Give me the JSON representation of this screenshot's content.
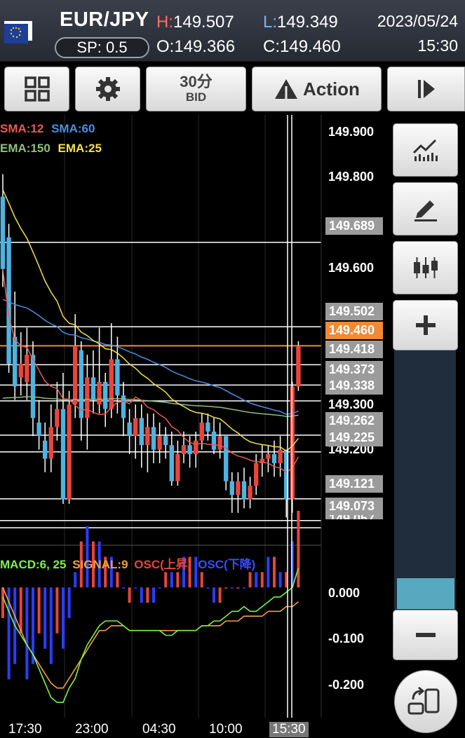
{
  "header": {
    "pair": "EUR/JPY",
    "spread": "SP: 0.5",
    "high_key": "H:",
    "high": "149.507",
    "open_key": "O:",
    "open": "149.366",
    "low_key": "L:",
    "low": "149.349",
    "close_key": "C:",
    "close": "149.460",
    "date": "2023/05/24",
    "time": "15:30"
  },
  "toolbar": {
    "timeframe": "30分",
    "price_type": "BID",
    "action_label": "Action"
  },
  "legend": {
    "sma12": "SMA:12",
    "sma60": "SMA:60",
    "ema150": "EMA:150",
    "ema25": "EMA:25",
    "macd": "MACD:6, 25",
    "signal": "SIGNAL:9",
    "osc_up": "OSC(上昇)",
    "osc_down": "OSC(下降)"
  },
  "price_axis": {
    "p1": "149.900",
    "p2": "149.800",
    "p3": "149.600",
    "p4": "149.300",
    "p5": "149.200"
  },
  "price_boxes": {
    "b1": "149.689",
    "b2": "149.502",
    "current": "149.460",
    "b3": "149.418",
    "b4": "149.373",
    "b5": "149.338",
    "b6": "149.262",
    "b7": "149.225",
    "b8": "149.121",
    "b9": "149.073",
    "b10": "149.057"
  },
  "macd_axis": {
    "m1": "0.000",
    "m2": "-0.100",
    "m3": "-0.200"
  },
  "time_axis": {
    "t1": "17:30",
    "t2": "23:00",
    "t3": "04:30",
    "t4": "10:00",
    "t5": "15:30"
  },
  "colors": {
    "bull": "#e8453c",
    "bear": "#4fb3e0",
    "sma12": "#e85a50",
    "sma60": "#4a90e2",
    "ema150": "#8fbf7f",
    "ema25": "#f4e04d",
    "macd": "#7cf24a",
    "signal": "#f5a040",
    "current_price": "#f08a35"
  },
  "chart_data": {
    "type": "candlestick",
    "candles": [
      {
        "o": 149.79,
        "c": 149.63,
        "h": 149.84,
        "l": 149.59
      },
      {
        "o": 149.7,
        "c": 149.42,
        "h": 149.73,
        "l": 149.4
      },
      {
        "o": 149.48,
        "c": 149.37,
        "h": 149.58,
        "l": 149.34
      },
      {
        "o": 149.39,
        "c": 149.42,
        "h": 149.49,
        "l": 149.35
      },
      {
        "o": 149.38,
        "c": 149.44,
        "h": 149.5,
        "l": 149.34
      },
      {
        "o": 149.44,
        "c": 149.3,
        "h": 149.47,
        "l": 149.26
      },
      {
        "o": 149.29,
        "c": 149.26,
        "h": 149.34,
        "l": 149.23
      },
      {
        "o": 149.25,
        "c": 149.21,
        "h": 149.29,
        "l": 149.18
      },
      {
        "o": 149.21,
        "c": 149.28,
        "h": 149.33,
        "l": 149.18
      },
      {
        "o": 149.28,
        "c": 149.32,
        "h": 149.38,
        "l": 149.25
      },
      {
        "o": 149.32,
        "c": 149.12,
        "h": 149.4,
        "l": 149.11
      },
      {
        "o": 149.12,
        "c": 149.33,
        "h": 149.36,
        "l": 149.11
      },
      {
        "o": 149.33,
        "c": 149.46,
        "h": 149.53,
        "l": 149.3
      },
      {
        "o": 149.45,
        "c": 149.3,
        "h": 149.47,
        "l": 149.25
      },
      {
        "o": 149.3,
        "c": 149.39,
        "h": 149.44,
        "l": 149.23
      },
      {
        "o": 149.39,
        "c": 149.34,
        "h": 149.45,
        "l": 149.31
      },
      {
        "o": 149.33,
        "c": 149.38,
        "h": 149.5,
        "l": 149.31
      },
      {
        "o": 149.38,
        "c": 149.32,
        "h": 149.4,
        "l": 149.28
      },
      {
        "o": 149.32,
        "c": 149.43,
        "h": 149.51,
        "l": 149.3
      },
      {
        "o": 149.43,
        "c": 149.35,
        "h": 149.48,
        "l": 149.31
      },
      {
        "o": 149.35,
        "c": 149.3,
        "h": 149.38,
        "l": 149.26
      },
      {
        "o": 149.29,
        "c": 149.26,
        "h": 149.32,
        "l": 149.22
      },
      {
        "o": 149.26,
        "c": 149.3,
        "h": 149.33,
        "l": 149.21
      },
      {
        "o": 149.3,
        "c": 149.24,
        "h": 149.33,
        "l": 149.19
      },
      {
        "o": 149.24,
        "c": 149.28,
        "h": 149.31,
        "l": 149.18
      },
      {
        "o": 149.28,
        "c": 149.23,
        "h": 149.31,
        "l": 149.2
      },
      {
        "o": 149.23,
        "c": 149.26,
        "h": 149.29,
        "l": 149.2
      },
      {
        "o": 149.26,
        "c": 149.24,
        "h": 149.28,
        "l": 149.21
      },
      {
        "o": 149.24,
        "c": 149.16,
        "h": 149.27,
        "l": 149.15
      },
      {
        "o": 149.16,
        "c": 149.22,
        "h": 149.25,
        "l": 149.15
      },
      {
        "o": 149.22,
        "c": 149.24,
        "h": 149.27,
        "l": 149.2
      },
      {
        "o": 149.24,
        "c": 149.22,
        "h": 149.26,
        "l": 149.19
      },
      {
        "o": 149.22,
        "c": 149.25,
        "h": 149.27,
        "l": 149.19
      },
      {
        "o": 149.25,
        "c": 149.29,
        "h": 149.31,
        "l": 149.23
      },
      {
        "o": 149.29,
        "c": 149.27,
        "h": 149.31,
        "l": 149.25
      },
      {
        "o": 149.27,
        "c": 149.23,
        "h": 149.3,
        "l": 149.22
      },
      {
        "o": 149.23,
        "c": 149.26,
        "h": 149.29,
        "l": 149.21
      },
      {
        "o": 149.26,
        "c": 149.16,
        "h": 149.26,
        "l": 149.14
      },
      {
        "o": 149.16,
        "c": 149.13,
        "h": 149.18,
        "l": 149.09
      },
      {
        "o": 149.13,
        "c": 149.16,
        "h": 149.18,
        "l": 149.09
      },
      {
        "o": 149.16,
        "c": 149.12,
        "h": 149.19,
        "l": 149.1
      },
      {
        "o": 149.12,
        "c": 149.15,
        "h": 149.17,
        "l": 149.1
      },
      {
        "o": 149.15,
        "c": 149.2,
        "h": 149.22,
        "l": 149.13
      },
      {
        "o": 149.2,
        "c": 149.21,
        "h": 149.24,
        "l": 149.17
      },
      {
        "o": 149.21,
        "c": 149.22,
        "h": 149.24,
        "l": 149.18
      },
      {
        "o": 149.22,
        "c": 149.2,
        "h": 149.25,
        "l": 149.17
      },
      {
        "o": 149.2,
        "c": 149.23,
        "h": 149.26,
        "l": 149.17
      },
      {
        "o": 149.23,
        "c": 149.12,
        "h": 149.23,
        "l": 149.08
      },
      {
        "o": 149.12,
        "c": 149.37,
        "h": 149.38,
        "l": 149.09
      },
      {
        "o": 149.37,
        "c": 149.46,
        "h": 149.47,
        "l": 149.36
      }
    ],
    "macd_osc": [
      -0.02,
      -0.06,
      -0.05,
      -0.03,
      -0.06,
      -0.05,
      -0.03,
      -0.04,
      -0.05,
      -0.03,
      -0.04,
      -0.02,
      0.01,
      0.03,
      0.04,
      0.03,
      0.03,
      0.02,
      0.02,
      0.01,
      0.0,
      -0.01,
      0.0,
      -0.01,
      -0.01,
      -0.01,
      0.0,
      0.01,
      0.01,
      0.01,
      0.02,
      0.02,
      0.02,
      0.01,
      0.0,
      -0.01,
      -0.01,
      0.0,
      0.0,
      0.0,
      0.0,
      0.01,
      0.01,
      0.01,
      0.02,
      0.02,
      0.01,
      0.01,
      0.03,
      0.05
    ],
    "macd_line": [
      -0.02,
      -0.05,
      -0.08,
      -0.1,
      -0.12,
      -0.14,
      -0.17,
      -0.2,
      -0.23,
      -0.24,
      -0.24,
      -0.21,
      -0.19,
      -0.15,
      -0.12,
      -0.1,
      -0.08,
      -0.07,
      -0.07,
      -0.07,
      -0.08,
      -0.09,
      -0.09,
      -0.09,
      -0.09,
      -0.09,
      -0.09,
      -0.1,
      -0.1,
      -0.09,
      -0.09,
      -0.09,
      -0.09,
      -0.08,
      -0.08,
      -0.07,
      -0.07,
      -0.06,
      -0.05,
      -0.05,
      -0.04,
      -0.05,
      -0.05,
      -0.04,
      -0.03,
      -0.02,
      -0.02,
      -0.01,
      0.0,
      0.04
    ],
    "signal_line": [
      0.0,
      -0.03,
      -0.06,
      -0.09,
      -0.12,
      -0.14,
      -0.16,
      -0.18,
      -0.2,
      -0.21,
      -0.21,
      -0.19,
      -0.17,
      -0.15,
      -0.13,
      -0.11,
      -0.09,
      -0.09,
      -0.08,
      -0.08,
      -0.08,
      -0.09,
      -0.09,
      -0.09,
      -0.09,
      -0.09,
      -0.09,
      -0.09,
      -0.09,
      -0.09,
      -0.09,
      -0.09,
      -0.09,
      -0.08,
      -0.08,
      -0.08,
      -0.08,
      -0.07,
      -0.07,
      -0.07,
      -0.06,
      -0.06,
      -0.06,
      -0.06,
      -0.05,
      -0.05,
      -0.05,
      -0.04,
      -0.04,
      -0.03
    ],
    "price_range": [
      149.04,
      149.94
    ],
    "macd_range": [
      -0.25,
      0.05
    ]
  }
}
